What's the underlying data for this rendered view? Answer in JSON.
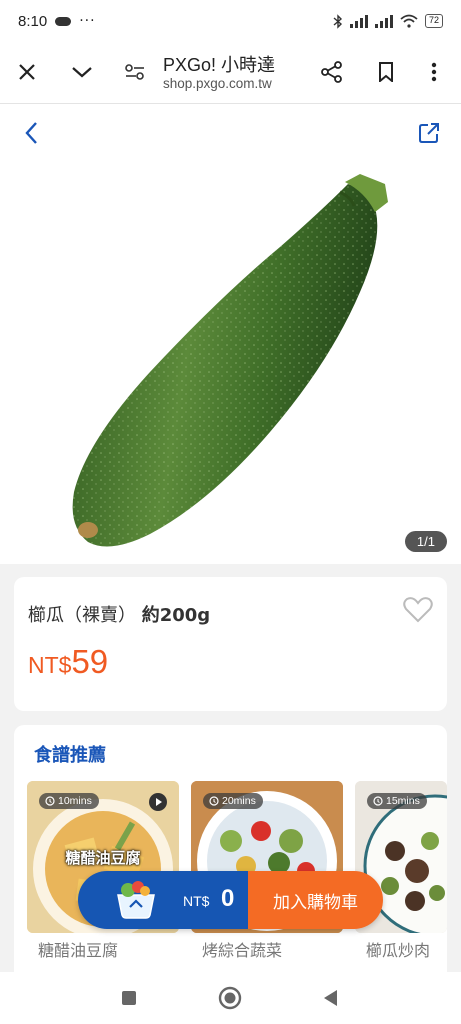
{
  "status_bar": {
    "time": "8:10",
    "dots": "···",
    "battery": "72"
  },
  "browser": {
    "title": "PXGo! 小時達",
    "url": "shop.pxgo.com.tw"
  },
  "product": {
    "image_counter": "1/1",
    "name_main": "櫛瓜（裸賣）",
    "name_weight": "約200g",
    "currency": "NT$",
    "price": "59"
  },
  "recipes": {
    "title": "食譜推薦",
    "items": [
      {
        "time": "10mins",
        "overlay": "糖醋油豆腐",
        "name": "糖醋油豆腐"
      },
      {
        "time": "20mins",
        "overlay": "",
        "name": "烤綜合蔬菜"
      },
      {
        "time": "15mins",
        "overlay": "",
        "name": "櫛瓜炒肉"
      }
    ]
  },
  "cart": {
    "currency": "NT$",
    "amount": "0",
    "add_label": "加入購物車"
  },
  "colors": {
    "brand_blue": "#1656b3",
    "accent_orange": "#f46b24",
    "price_orange": "#f05a22"
  },
  "icons": [
    "cloud-icon",
    "bluetooth-icon",
    "signal-icon",
    "wifi-icon",
    "battery-icon",
    "close-icon",
    "chevron-down-icon",
    "site-settings-icon",
    "share-icon",
    "bookmark-icon",
    "more-icon",
    "back-icon",
    "external-link-icon",
    "heart-icon",
    "timer-icon",
    "play-icon",
    "basket-icon",
    "recents-icon",
    "home-icon",
    "back-triangle-icon"
  ]
}
